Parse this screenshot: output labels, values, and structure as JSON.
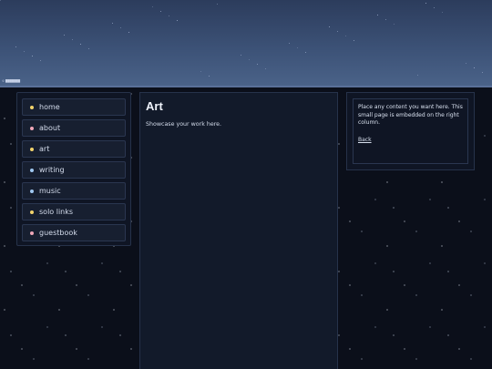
{
  "banner": {
    "credit": "© ███████"
  },
  "nav": {
    "items": [
      {
        "label": "home",
        "dot_color": "#f2d36b"
      },
      {
        "label": "about",
        "dot_color": "#f0a7b8"
      },
      {
        "label": "art",
        "dot_color": "#f2d36b"
      },
      {
        "label": "writing",
        "dot_color": "#9fc8f0"
      },
      {
        "label": "music",
        "dot_color": "#9fc8f0"
      },
      {
        "label": "solo links",
        "dot_color": "#f2d36b"
      },
      {
        "label": "guestbook",
        "dot_color": "#f0a7b8"
      }
    ]
  },
  "main": {
    "title": "Art",
    "text": "Showcase your work here."
  },
  "sidebar_right": {
    "text": "Place any content you want here. This small page is embedded on the right column.",
    "link": "Back"
  },
  "colors": {
    "background": "#0b0f1a",
    "panel": "#0f1524",
    "banner_top": "#2c3c5c",
    "banner_bottom": "#4a6288"
  }
}
